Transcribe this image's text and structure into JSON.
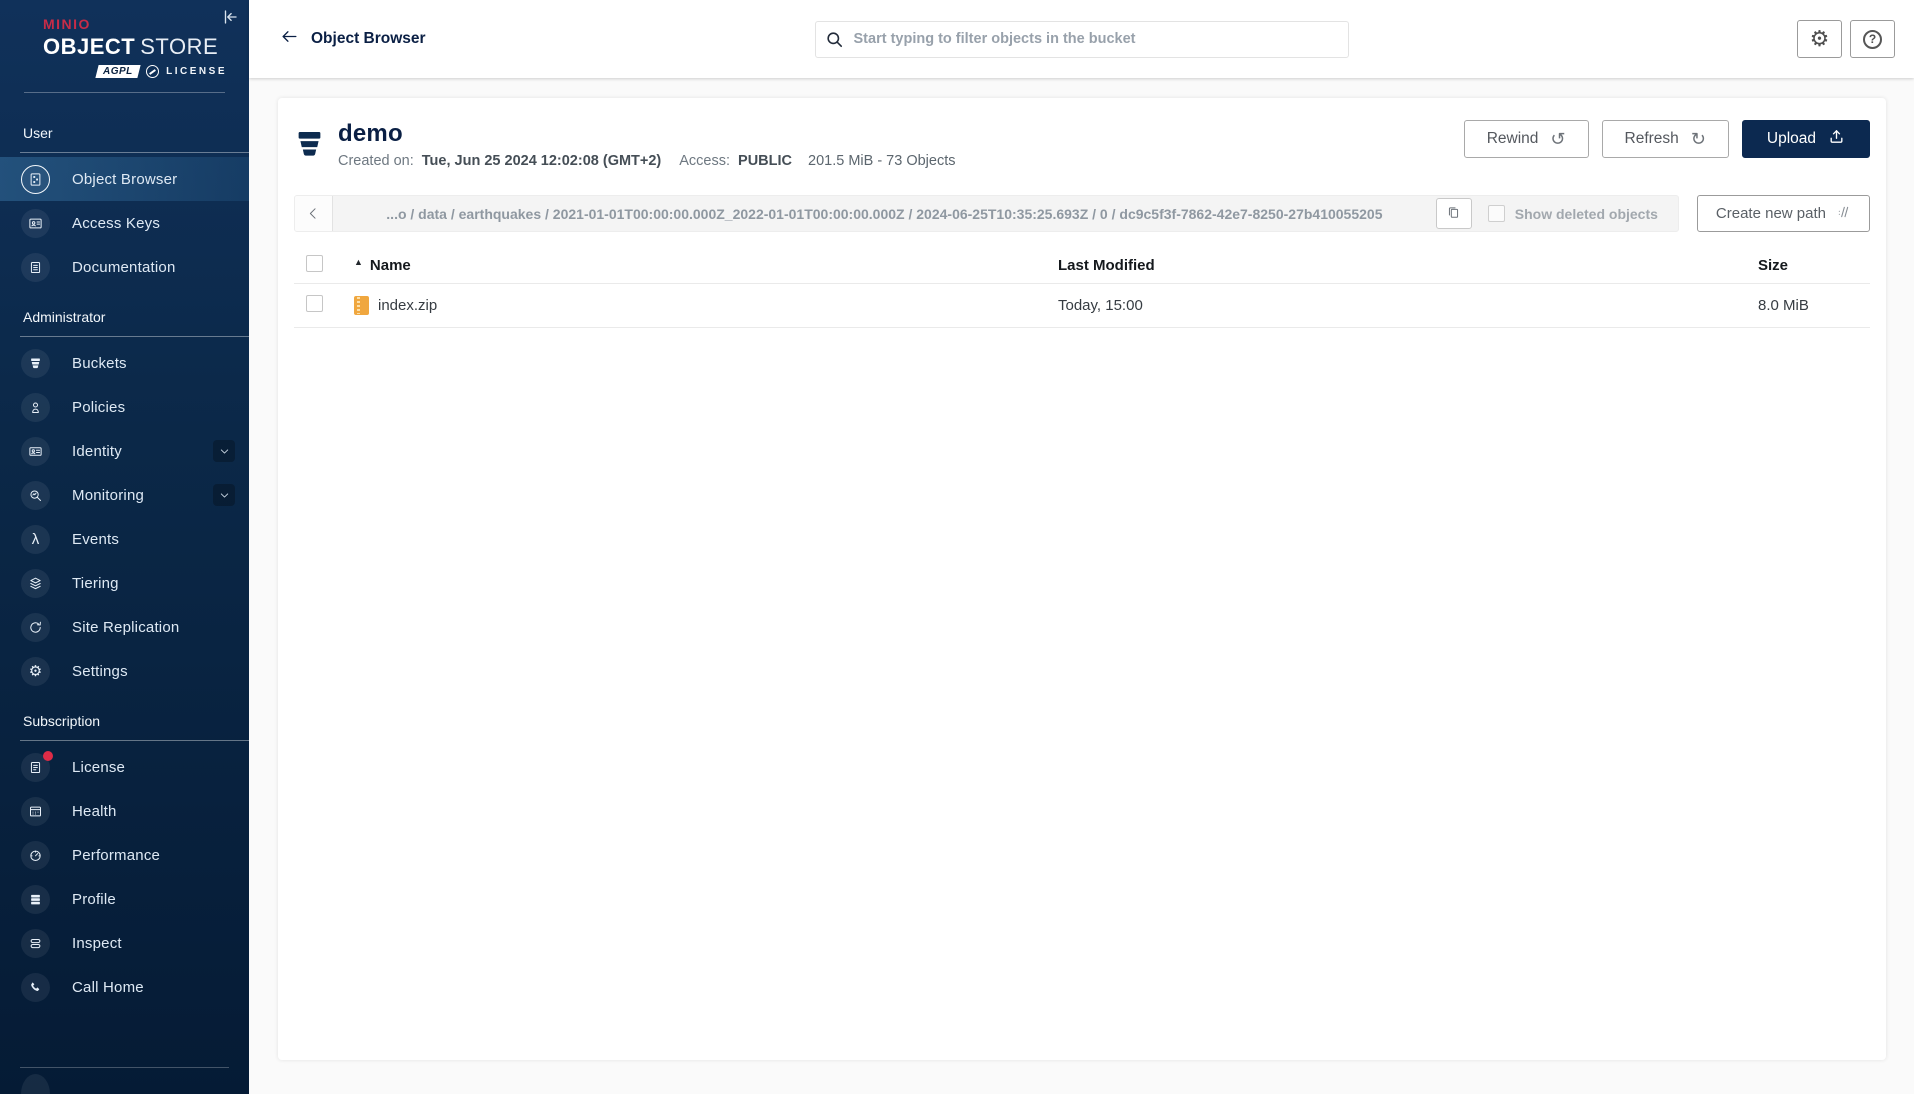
{
  "brand": {
    "minio": "MINIO",
    "product_bold": "OBJECT",
    "product_light": "STORE",
    "badge_agpl": "AGPL",
    "license_word": "LICENSE"
  },
  "topbar": {
    "title": "Object Browser",
    "search_placeholder": "Start typing to filter objects in the bucket"
  },
  "sidebar": {
    "sections": [
      {
        "label": "User",
        "items": [
          {
            "icon": "object-browser",
            "label": "Object Browser",
            "active": true
          },
          {
            "icon": "access-keys",
            "label": "Access Keys"
          },
          {
            "icon": "documentation",
            "label": "Documentation"
          }
        ]
      },
      {
        "label": "Administrator",
        "items": [
          {
            "icon": "buckets",
            "label": "Buckets"
          },
          {
            "icon": "policies",
            "label": "Policies"
          },
          {
            "icon": "identity",
            "label": "Identity",
            "expandable": true
          },
          {
            "icon": "monitoring",
            "label": "Monitoring",
            "expandable": true
          },
          {
            "icon": "events",
            "label": "Events"
          },
          {
            "icon": "tiering",
            "label": "Tiering"
          },
          {
            "icon": "site-replication",
            "label": "Site Replication"
          },
          {
            "icon": "settings",
            "label": "Settings"
          }
        ]
      },
      {
        "label": "Subscription",
        "items": [
          {
            "icon": "license",
            "label": "License",
            "badge_dot": true
          },
          {
            "icon": "health",
            "label": "Health"
          },
          {
            "icon": "performance",
            "label": "Performance"
          },
          {
            "icon": "profile",
            "label": "Profile"
          },
          {
            "icon": "inspect",
            "label": "Inspect"
          },
          {
            "icon": "call-home",
            "label": "Call Home"
          }
        ]
      }
    ]
  },
  "bucket": {
    "name": "demo",
    "created_label": "Created on:",
    "created_value": "Tue, Jun 25 2024 12:02:08 (GMT+2)",
    "access_label": "Access:",
    "access_value": "PUBLIC",
    "usage": "201.5 MiB - 73 Objects"
  },
  "actions": {
    "rewind": "Rewind",
    "refresh": "Refresh",
    "upload": "Upload",
    "show_deleted": "Show deleted objects",
    "create_path": "Create new path"
  },
  "breadcrumb": {
    "path": "...o / data / earthquakes / 2021-01-01T00:00:00.000Z_2022-01-01T00:00:00.000Z / 2024-06-25T10:35:25.693Z / 0 / dc9c5f3f-7862-42e7-8250-27b410055205"
  },
  "table": {
    "columns": [
      "Name",
      "Last Modified",
      "Size"
    ],
    "rows": [
      {
        "icon": "zip-file",
        "name": "index.zip",
        "modified": "Today, 15:00",
        "size": "8.0 MiB"
      }
    ]
  },
  "colors": {
    "brand_red": "#C72C48",
    "navy": "#0C2950",
    "sidebar_top": "#10315A",
    "sidebar_bottom": "#051B35",
    "notification_red": "#DE2C47",
    "zip_icon_orange": "#F0A73F"
  }
}
